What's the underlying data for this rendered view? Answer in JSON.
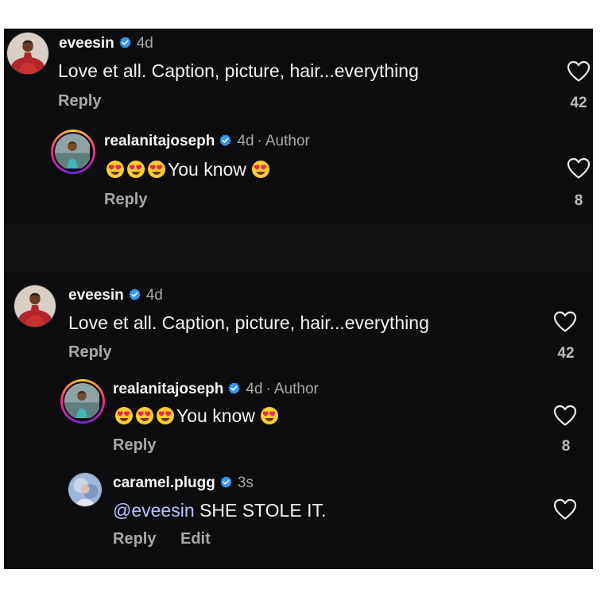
{
  "comments_top": {
    "parent": {
      "username": "eveesin",
      "time": "4d",
      "text": "Love et all. Caption, picture, hair...everything",
      "reply_label": "Reply",
      "likes": "42"
    },
    "reply": {
      "username": "realanitajoseph",
      "time": "4d",
      "author_label": "Author",
      "text": "You know",
      "reply_label": "Reply",
      "likes": "8"
    }
  },
  "comments_bottom": {
    "parent": {
      "username": "eveesin",
      "time": "4d",
      "text": "Love et all. Caption, picture, hair...everything",
      "reply_label": "Reply",
      "likes": "42"
    },
    "reply": {
      "username": "realanitajoseph",
      "time": "4d",
      "author_label": "Author",
      "text": "You know",
      "reply_label": "Reply",
      "likes": "8"
    },
    "reply2": {
      "username": "caramel.plugg",
      "time": "3s",
      "mention": "@eveesin",
      "text": "SHE STOLE IT.",
      "reply_label": "Reply",
      "edit_label": "Edit"
    }
  },
  "icons": {
    "verified": "verified-badge-icon",
    "heart": "heart-outline-icon",
    "emoji": "heart-eyes-emoji"
  },
  "colors": {
    "background": "#0d0d0f",
    "verified_blue": "#3897f0",
    "mention": "#b9c3ff",
    "muted": "#a8a8a8"
  }
}
